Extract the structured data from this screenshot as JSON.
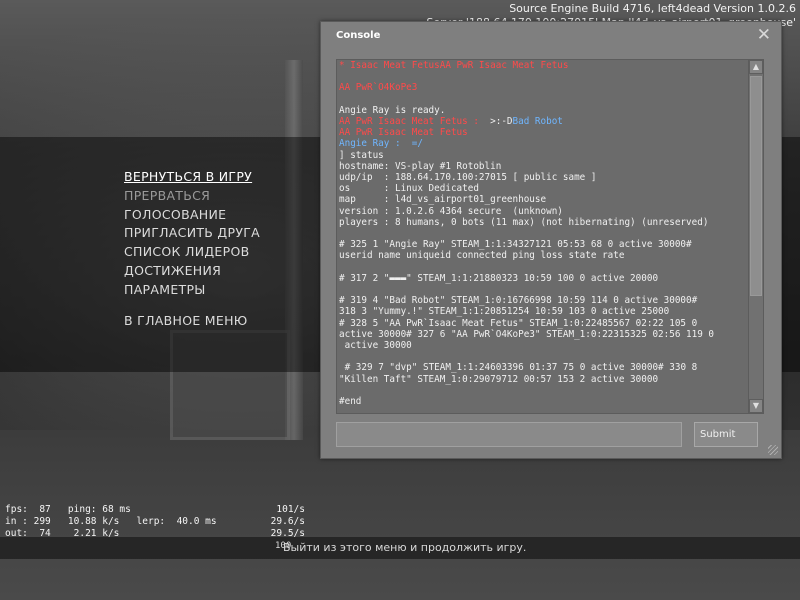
{
  "build_info": {
    "line1": "Source Engine Build 4716, left4dead Version 1.0.2.6",
    "line2": "Server '188.64.170.100:27015' Map 'l4d_vs_airport01_greenhouse'"
  },
  "main_menu": {
    "items": [
      "ВЕРНУТЬСЯ В ИГРУ",
      "ПРЕРВАТЬСЯ",
      "ГОЛОСОВАНИЕ",
      "ПРИГЛАСИТЬ ДРУГА",
      "СПИСОК ЛИДЕРОВ",
      "ДОСТИЖЕНИЯ",
      "ПАРАМЕТРЫ"
    ],
    "bottom_item": "В ГЛАВНОЕ МЕНЮ"
  },
  "console": {
    "title": "Console",
    "close_glyph": "✕",
    "submit_label": "Submit",
    "input_value": "",
    "lines": [
      {
        "style": "red",
        "text": "* Isaac Meat FetusAA PwR Isaac Meat Fetus"
      },
      {
        "style": "",
        "text": " "
      },
      {
        "style": "red",
        "text": "AA PwR`O4KoPe3"
      },
      {
        "style": "",
        "text": " "
      },
      {
        "style": "",
        "text": "Angie Ray is ready."
      },
      {
        "style": "mix1",
        "a": "AA PwR Isaac Meat Fetus :  ",
        "b": ">:-D",
        "c": "Bad Robot"
      },
      {
        "style": "red",
        "text": "AA PwR Isaac Meat Fetus"
      },
      {
        "style": "mix2",
        "a": "Angie Ray :  ",
        "b": "=/"
      },
      {
        "style": "",
        "text": "] status"
      },
      {
        "style": "",
        "text": "hostname: VS-play #1 Rotoblin"
      },
      {
        "style": "",
        "text": "udp/ip  : 188.64.170.100:27015 [ public same ]"
      },
      {
        "style": "",
        "text": "os      : Linux Dedicated"
      },
      {
        "style": "",
        "text": "map     : l4d_vs_airport01_greenhouse"
      },
      {
        "style": "",
        "text": "version : 1.0.2.6 4364 secure  (unknown)"
      },
      {
        "style": "",
        "text": "players : 8 humans, 0 bots (11 max) (not hibernating) (unreserved)"
      },
      {
        "style": "",
        "text": " "
      },
      {
        "style": "",
        "text": "# 325 1 \"Angie Ray\" STEAM_1:1:34327121 05:53 68 0 active 30000#"
      },
      {
        "style": "",
        "text": "userid name uniqueid connected ping loss state rate"
      },
      {
        "style": "",
        "text": " "
      },
      {
        "style": "",
        "text": "# 317 2 \"▬▬▬\" STEAM_1:1:21880323 10:59 100 0 active 20000"
      },
      {
        "style": "",
        "text": " "
      },
      {
        "style": "",
        "text": "# 319 4 \"Bad Robot\" STEAM_1:0:16766998 10:59 114 0 active 30000#"
      },
      {
        "style": "",
        "text": "318 3 \"Yummy.!\" STEAM_1:1:20851254 10:59 103 0 active 25000"
      },
      {
        "style": "",
        "text": "# 328 5 \"AA PwR`Isaac Meat Fetus\" STEAM_1:0:22485567 02:22 105 0"
      },
      {
        "style": "",
        "text": "active 30000# 327 6 \"AA PwR`O4KoPe3\" STEAM_1:0:22315325 02:56 119 0"
      },
      {
        "style": "",
        "text": " active 30000"
      },
      {
        "style": "",
        "text": " "
      },
      {
        "style": "",
        "text": " # 329 7 \"dvp\" STEAM_1:1:24603396 01:37 75 0 active 30000# 330 8"
      },
      {
        "style": "",
        "text": "\"Killen Taft\" STEAM_1:0:29079712 00:57 153 2 active 30000"
      },
      {
        "style": "",
        "text": " "
      },
      {
        "style": "",
        "text": "#end"
      }
    ]
  },
  "netgraph": {
    "rows": [
      {
        "left": "fps:  87   ping: 68 ms",
        "right": "101/s"
      },
      {
        "left": "in : 299   10.88 k/s   lerp:  40.0 ms",
        "right": "29.6/s"
      },
      {
        "left": "out:  74    2.21 k/s",
        "right": "29.5/s"
      },
      {
        "left": "",
        "right": ""
      }
    ],
    "below": "100"
  },
  "hint": "Выйти из этого меню и продолжить игру."
}
